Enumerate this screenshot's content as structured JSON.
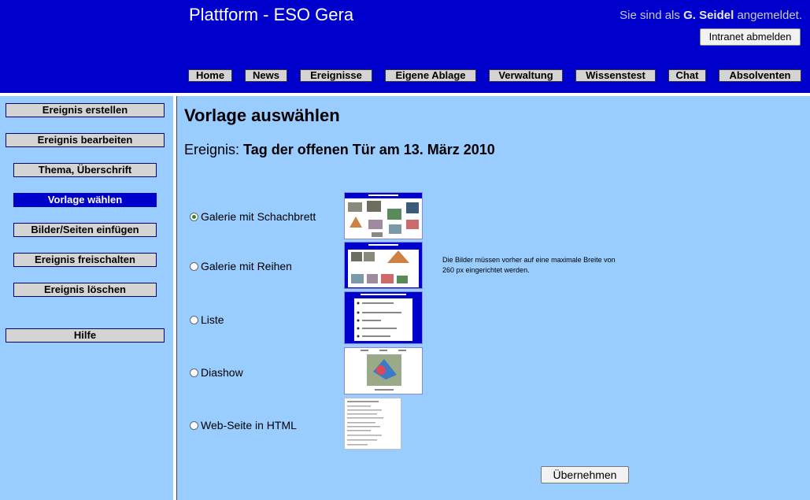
{
  "header": {
    "title": "Plattform - ESO Gera",
    "login_prefix": "Sie sind als",
    "login_user": "G. Seidel",
    "login_suffix": "angemeldet.",
    "logout_label": "Intranet abmelden",
    "nav": [
      "Home",
      "News",
      "Ereignisse",
      "Eigene Ablage",
      "Verwaltung",
      "Wissenstest",
      "Chat",
      "Absolventen"
    ]
  },
  "sidebar": {
    "items": [
      "Ereignis erstellen",
      "Ereignis bearbeiten",
      "Thema, Überschrift",
      "Vorlage wählen",
      "Bilder/Seiten einfügen",
      "Ereignis freischalten",
      "Ereignis löschen",
      "Hilfe"
    ],
    "active_index": 3
  },
  "main": {
    "title": "Vorlage auswählen",
    "event_label": "Ereignis:",
    "event_name": "Tag der offenen Tür am 13. März 2010",
    "options": [
      {
        "label": "Galerie mit Schachbrett",
        "selected": true
      },
      {
        "label": "Galerie mit Reihen",
        "selected": false
      },
      {
        "label": "Liste",
        "selected": false
      },
      {
        "label": "Diashow",
        "selected": false
      },
      {
        "label": "Web-Seite in HTML",
        "selected": false
      }
    ],
    "note": "Die Bilder müssen vorher auf eine maximale Breite von 260 px eingerichtet werden.",
    "submit_label": "Übernehmen"
  },
  "colors": {
    "header_bg": "#0000cc",
    "page_bg": "#99ccff",
    "active_item_bg": "#0000cc"
  }
}
